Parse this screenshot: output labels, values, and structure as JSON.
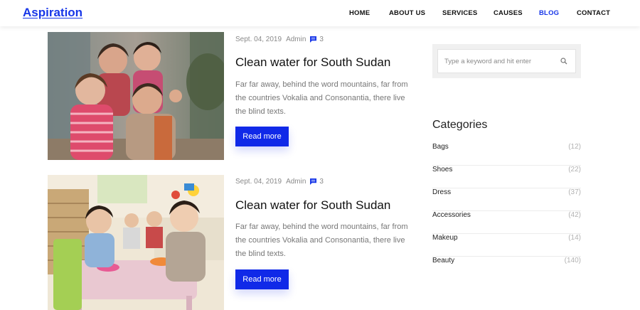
{
  "header": {
    "brand": "Aspiration",
    "nav": [
      {
        "label": "HOME"
      },
      {
        "label": "ABOUT US"
      },
      {
        "label": "SERVICES"
      },
      {
        "label": "CAUSES"
      },
      {
        "label": "BLOG",
        "active": true
      },
      {
        "label": "CONTACT"
      }
    ]
  },
  "posts": [
    {
      "date": "Sept. 04, 2019",
      "author": "Admin",
      "comments": "3",
      "title": "Clean water for South Sudan",
      "excerpt": "Far far away, behind the word mountains, far from the countries Vokalia and Consonantia, there live the blind texts.",
      "button": "Read more"
    },
    {
      "date": "Sept. 04, 2019",
      "author": "Admin",
      "comments": "3",
      "title": "Clean water for South Sudan",
      "excerpt": "Far far away, behind the word mountains, far from the countries Vokalia and Consonantia, there live the blind texts.",
      "button": "Read more"
    }
  ],
  "sidebar": {
    "search_placeholder": "Type a keyword and hit enter",
    "categories_heading": "Categories",
    "categories": [
      {
        "name": "Bags",
        "count": "(12)"
      },
      {
        "name": "Shoes",
        "count": "(22)"
      },
      {
        "name": "Dress",
        "count": "(37)"
      },
      {
        "name": "Accessories",
        "count": "(42)"
      },
      {
        "name": "Makeup",
        "count": "(14)"
      },
      {
        "name": "Beauty",
        "count": "(140)"
      }
    ]
  },
  "colors": {
    "accent": "#1029e8",
    "brand": "#1736e8"
  }
}
